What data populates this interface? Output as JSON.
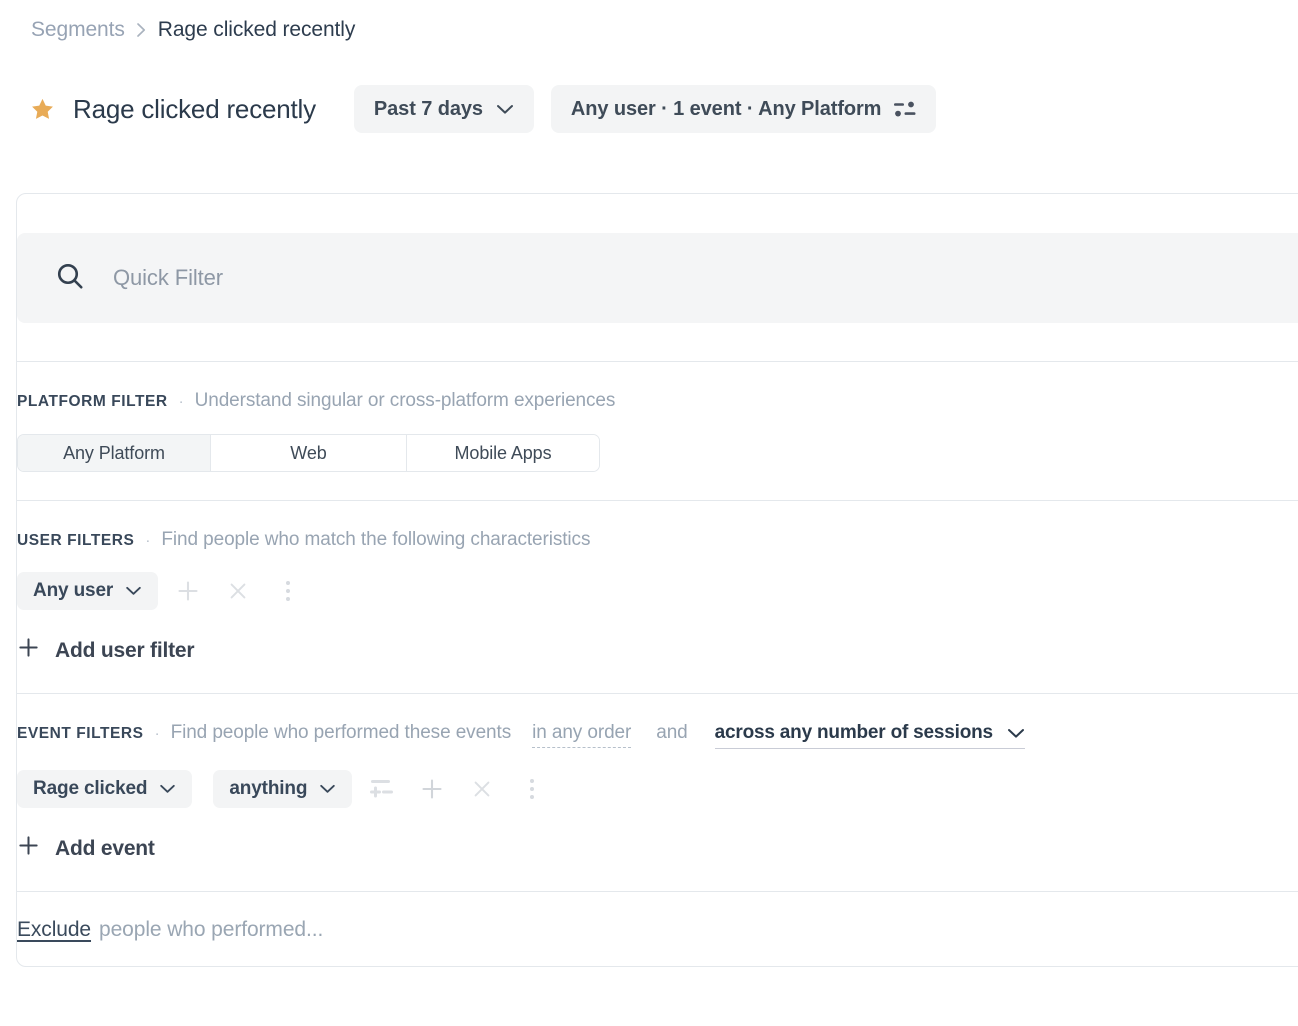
{
  "breadcrumb": {
    "parent": "Segments",
    "separator": "›",
    "current": "Rage clicked recently"
  },
  "header": {
    "star_icon": "star-icon",
    "title": "Rage clicked recently",
    "date_range_pill": "Past 7 days",
    "summary_pill": "Any user · 1 event · Any Platform",
    "summary_icon": "sliders-icon",
    "chevron_icon": "chevron-down-icon"
  },
  "search": {
    "icon": "search-icon",
    "placeholder": "Quick Filter",
    "value": ""
  },
  "platform_filter": {
    "label": "PLATFORM FILTER",
    "dot": "·",
    "description": "Understand singular or cross-platform experiences",
    "options": [
      "Any Platform",
      "Web",
      "Mobile Apps"
    ],
    "selected": "Any Platform"
  },
  "user_filters": {
    "label": "USER FILTERS",
    "dot": "·",
    "description": "Find people who match the following characteristics",
    "rows": [
      {
        "value": "Any user"
      }
    ],
    "row_actions": [
      "plus-icon",
      "close-icon",
      "kebab-menu-icon"
    ],
    "add_label": "Add user filter",
    "add_icon": "plus-icon"
  },
  "event_filters": {
    "label": "EVENT FILTERS",
    "dot": "·",
    "description": "Find people who performed these events",
    "order_dropdown": "in any order",
    "conjunction": "and",
    "sessions_dropdown": "across any number of sessions",
    "rows": [
      {
        "event": "Rage clicked",
        "qualifier": "anything"
      }
    ],
    "row_actions": [
      "add-property-filter-icon",
      "plus-icon",
      "close-icon",
      "kebab-menu-icon"
    ],
    "add_label": "Add event",
    "add_icon": "plus-icon"
  },
  "exclude": {
    "link": "Exclude",
    "rest": "people who performed..."
  },
  "colors": {
    "star": "#e8ab57",
    "text_dark": "#2b3a4b",
    "text_muted": "#98a4b2",
    "pill_bg": "#f3f4f5",
    "border": "#e4e8ec"
  }
}
